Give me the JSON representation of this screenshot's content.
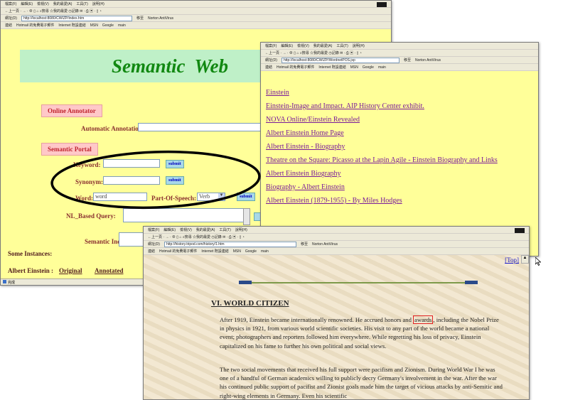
{
  "common": {
    "menu": [
      "檔案(F)",
      "編輯(E)",
      "檢視(V)",
      "我的最愛(A)",
      "工具(T)",
      "說明(H)"
    ],
    "toolbar": "←上一頁 · → · ⊗ ▯ ⌂   ⌕搜尋  ☆我的最愛  ◷記錄   ✉ · ⎙ ▣ · ▯ ◔",
    "address_label": "網址(D)",
    "go_label": "移至",
    "links_label": "連結",
    "links": [
      "Hotmail 的免費電子郵件",
      "Internet 既設連結",
      "MSN",
      "Google",
      "main"
    ],
    "norton": "Norton AntiVirus"
  },
  "win1": {
    "address": "http://localhost:8080/CWIZP/index.htm",
    "title": "Semantic  Web",
    "online_annotator": "Online Annotator",
    "auto_annotation_label": "Automatic Annotation:",
    "semantic_portal": "Semantic Portal",
    "keyword_label": "Keyword:",
    "submit": "submit",
    "synonym_label": "Synonym:",
    "word_label": "Word:",
    "word_value": "word",
    "pos_label": "Part-Of-Speech:",
    "pos_value": "Verb",
    "nl_query_label": "NL_Based Query:",
    "semantic_index_label": "Semantic Index:",
    "some_instances": "Some Instances:",
    "instance_name": "Albert Einstein :",
    "original": "Original",
    "annotated": "Annotated",
    "status": "完成"
  },
  "win2": {
    "address": "http://localhost:8080/CWIZP/WordnetPOS.jsp",
    "results": [
      "Einstein",
      "Einstein-Image and Impact. AIP History Center exhibit.",
      "NOVA Online/Einstein Revealed",
      "Albert Einstein Home Page",
      "Albert Einstein - Biography",
      "Theatre on the Square: Picasso at the Lapin Agile - Einstein Biography and Links",
      "Albert Einstein Biography",
      "Biography - Albert Einstein",
      "Albert Einstein (1879-1955) - By Miles Hodges"
    ]
  },
  "win3": {
    "address": "http://history.tripod.com/history/1.htm",
    "top_link": "[Top]",
    "heading": "VI. WORLD CITIZEN",
    "para1_before": "After 1919, Einstein became internationally renowned. He accrued honors and ",
    "para1_highlight": "awards",
    "para1_after": ", including the Nobel Prize in physics in 1921, from various world scientific societies. His visit to any part of the world became a national event; photographers and reporters followed him everywhere. While regretting his loss of privacy, Einstein capitalized on his fame to further his own political and social views.",
    "para2": "The two social movements that received his full support were pacifism and Zionism. During World War I he was one of a handful of German academics willing to publicly decry Germany's involvement in the war. After the war his continued public support of pacifist and Zionist goals made him the target of vicious attacks by anti-Semitic and right-wing elements in Germany. Even his scientific"
  },
  "colors": {
    "page_yellow": "#ffff99",
    "link_purple": "#7a1a9a",
    "title_green": "#118811",
    "title_banner": "#bff0c8",
    "pink_button": "#ffc8c8",
    "highlight_red": "#e02020"
  }
}
